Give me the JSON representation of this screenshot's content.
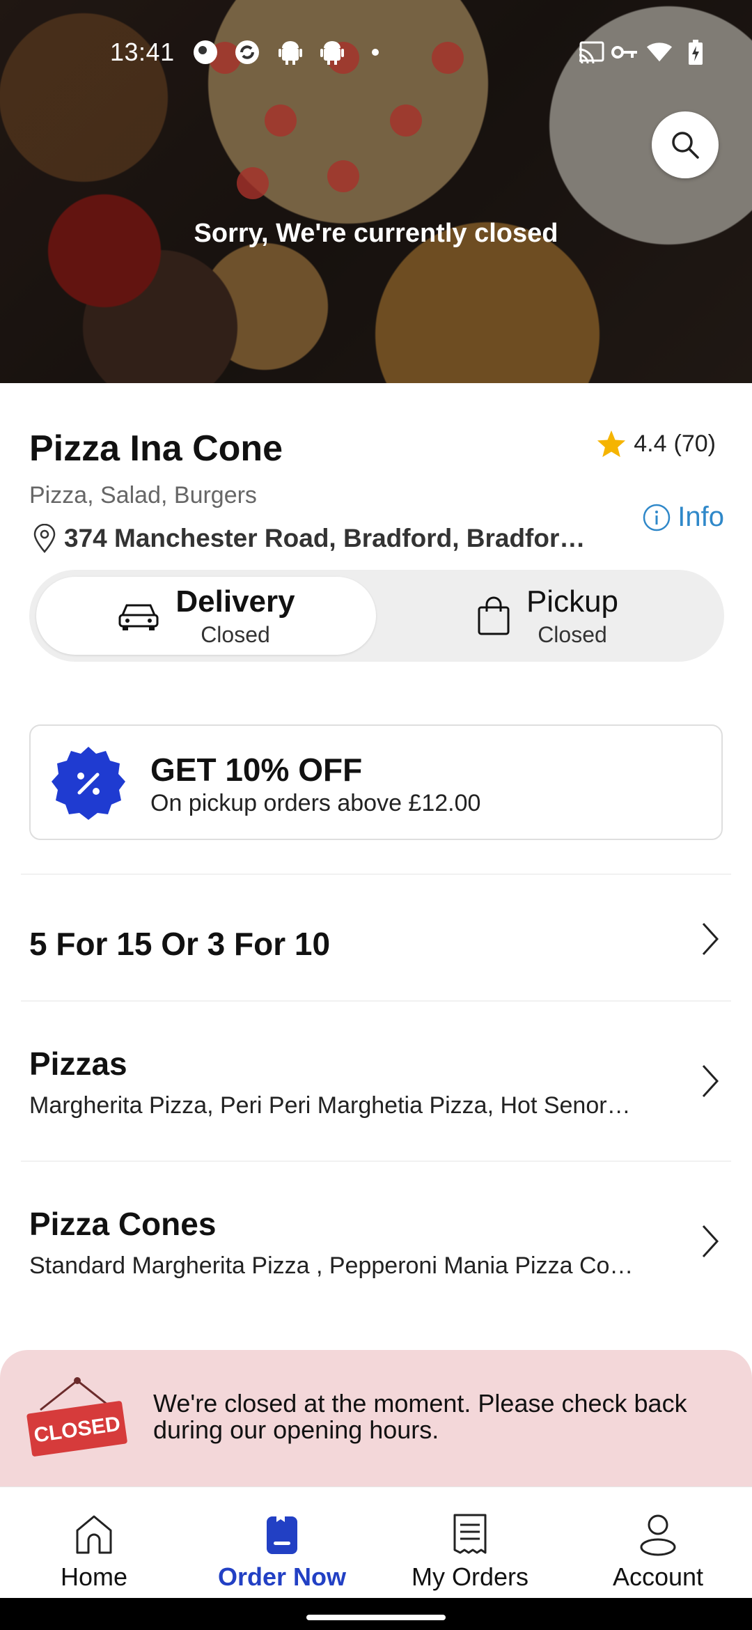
{
  "status_bar": {
    "time": "13:41"
  },
  "hero": {
    "closed_message": "Sorry, We're currently closed"
  },
  "restaurant": {
    "name": "Pizza Ina Cone",
    "rating": "4.4",
    "rating_count": "(70)",
    "cuisines": "Pizza, Salad, Burgers",
    "info_label": "Info",
    "address": "374 Manchester Road, Bradford, Bradfor…"
  },
  "order_mode": {
    "delivery": {
      "label": "Delivery",
      "status": "Closed"
    },
    "pickup": {
      "label": "Pickup",
      "status": "Closed"
    }
  },
  "offer": {
    "title": "GET 10% OFF",
    "subtitle": "On pickup orders above £12.00"
  },
  "categories": [
    {
      "title": "5 For 15 Or 3 For 10",
      "description": ""
    },
    {
      "title": "Pizzas",
      "description": "Margherita Pizza, Peri Peri Marghetia Pizza, Hot Senor…"
    },
    {
      "title": "Pizza Cones",
      "description": "Standard Margherita Pizza , Pepperoni Mania Pizza Co…"
    }
  ],
  "closed_banner": {
    "sign_text": "CLOSED",
    "message": "We're closed at the moment. Please check back during our opening hours."
  },
  "bottom_nav": {
    "items": [
      {
        "label": "Home",
        "icon": "home-icon"
      },
      {
        "label": "Order Now",
        "icon": "order-now-icon"
      },
      {
        "label": "My Orders",
        "icon": "receipt-icon"
      },
      {
        "label": "Account",
        "icon": "person-icon"
      }
    ],
    "active": "Order Now"
  },
  "colors": {
    "accent": "#2240c4",
    "info": "#2f88c9",
    "star": "#f5b400",
    "closed_banner_bg": "#f3d7d9",
    "closed_sign": "#d63b3b"
  }
}
